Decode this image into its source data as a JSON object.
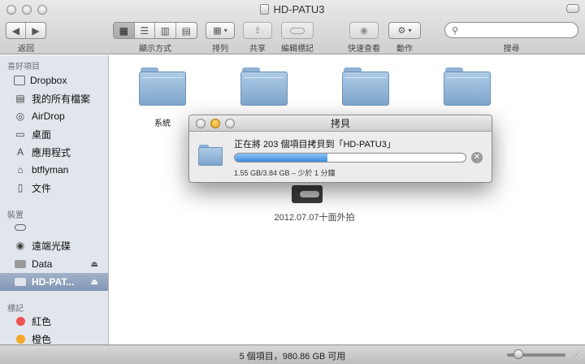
{
  "window": {
    "title": "HD-PATU3"
  },
  "toolbar": {
    "back_label": "返回",
    "view_label": "顯示方式",
    "arrange_label": "排列",
    "share_label": "共享",
    "tags_label": "編輯標記",
    "quicklook_label": "快速查看",
    "action_label": "動作",
    "search_label": "搜尋",
    "search_placeholder": ""
  },
  "sidebar": {
    "favorites_header": "喜好項目",
    "favorites": [
      {
        "label": "Dropbox",
        "icon": "dropbox-icon"
      },
      {
        "label": "我的所有檔案",
        "icon": "all-files-icon"
      },
      {
        "label": "AirDrop",
        "icon": "airdrop-icon"
      },
      {
        "label": "桌面",
        "icon": "desktop-icon"
      },
      {
        "label": "應用程式",
        "icon": "applications-icon"
      },
      {
        "label": "btflyman",
        "icon": "home-icon"
      },
      {
        "label": "文件",
        "icon": "documents-icon"
      }
    ],
    "devices_header": "裝置",
    "devices": [
      {
        "label": "遠端光碟",
        "icon": "remote-disc-icon"
      },
      {
        "label": "Data",
        "icon": "drive-icon"
      },
      {
        "label": "HD-PAT...",
        "icon": "drive-icon"
      }
    ],
    "tags_header": "標記",
    "tags": [
      {
        "label": "紅色",
        "color": "#f0524f"
      },
      {
        "label": "橙色",
        "color": "#f5a623"
      }
    ]
  },
  "content": {
    "folders": [
      {
        "label": "系統"
      },
      {
        "label": ""
      },
      {
        "label": ""
      },
      {
        "label": ""
      }
    ],
    "drive_label": "2012.07.07十面外拍"
  },
  "copy_dialog": {
    "title": "拷貝",
    "message": "正在將 203 個項目拷貝到「HD-PATU3」",
    "progress_fraction": 0.4,
    "status": "1.55 GB/3.84 GB – 少於 1 分鐘"
  },
  "statusbar": {
    "text": "5 個項目，980.86 GB 可用",
    "icon_size_fraction": 0.2
  },
  "colors": {
    "accent": "#3d8de0",
    "sidebar_bg": "#e1e6ed",
    "selection": "#8195b4"
  }
}
